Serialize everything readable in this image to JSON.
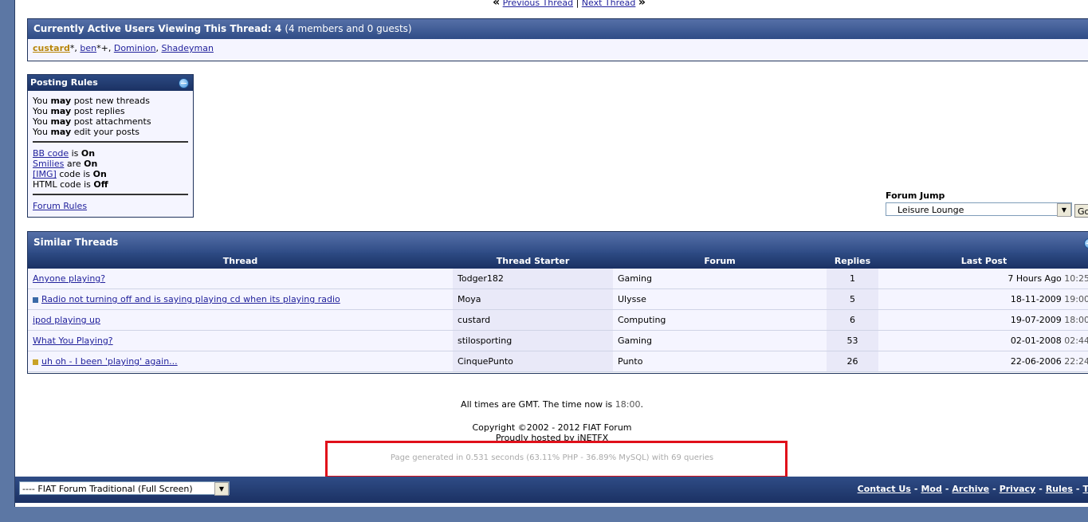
{
  "thread_nav": {
    "prev": "Previous Thread",
    "sep": "|",
    "next": "Next Thread"
  },
  "active_users": {
    "title": "Currently Active Users Viewing This Thread:",
    "count": "4",
    "detail": "(4 members and 0 guests)",
    "users": [
      {
        "name": "custard",
        "suffix": "*, "
      },
      {
        "name": "ben",
        "suffix": "*+, "
      },
      {
        "name": "Dominion",
        "suffix": ", "
      },
      {
        "name": "Shadeyman",
        "suffix": ""
      }
    ]
  },
  "posting_rules": {
    "title": "Posting Rules",
    "may": "may",
    "rules": [
      {
        "pre": "You",
        "post": "post new threads"
      },
      {
        "pre": "You",
        "post": "post replies"
      },
      {
        "pre": "You",
        "post": "post attachments"
      },
      {
        "pre": "You",
        "post": "edit your posts"
      }
    ],
    "codes": [
      {
        "link": "BB code",
        "mid": " is ",
        "state": "On"
      },
      {
        "link": "Smilies",
        "mid": " are ",
        "state": "On"
      },
      {
        "link": "[IMG]",
        "mid": " code is ",
        "state": "On"
      },
      {
        "link": "",
        "text": "HTML code is ",
        "state": "Off"
      }
    ],
    "forum_rules": "Forum Rules"
  },
  "forum_jump": {
    "label": "Forum Jump",
    "selected": "Leisure Lounge",
    "go": "Go"
  },
  "similar_threads": {
    "title": "Similar Threads",
    "columns": [
      "Thread",
      "Thread Starter",
      "Forum",
      "Replies",
      "Last Post"
    ],
    "rows": [
      {
        "thread": "Anyone playing?",
        "icon": "",
        "starter": "Todger182",
        "forum": "Gaming",
        "replies": "1",
        "last_date": "7 Hours Ago",
        "last_time": "10:25"
      },
      {
        "thread": "Radio not turning off and is saying playing cd when its playing radio",
        "icon": "#3a6aa8",
        "starter": "Moya",
        "forum": "Ulysse",
        "replies": "5",
        "last_date": "18-11-2009",
        "last_time": "19:00"
      },
      {
        "thread": "ipod playing up",
        "icon": "",
        "starter": "custard",
        "forum": "Computing",
        "replies": "6",
        "last_date": "19-07-2009",
        "last_time": "18:00"
      },
      {
        "thread": "What You Playing?",
        "icon": "",
        "starter": "stilosporting",
        "forum": "Gaming",
        "replies": "53",
        "last_date": "02-01-2008",
        "last_time": "02:44"
      },
      {
        "thread": "uh oh - I been 'playing' again...",
        "icon": "#c9a227",
        "starter": "CinquePunto",
        "forum": "Punto",
        "replies": "26",
        "last_date": "22-06-2006",
        "last_time": "22:24"
      }
    ]
  },
  "footer": {
    "times_pre": "All times are GMT. The time now is ",
    "time_now": "18:00",
    "times_post": ".",
    "copyright": "Copyright ©2002 - 2012 FIAT Forum",
    "hosted": "Proudly hosted by iNETFX",
    "page_generated": "Page generated in 0.531 seconds (63.11% PHP - 36.89% MySQL) with 69 queries"
  },
  "bottom_bar": {
    "style_selected": "---- FIAT Forum Traditional (Full Screen)",
    "links": [
      "Contact Us",
      "Mod",
      "Archive",
      "Privacy",
      "Rules",
      "T"
    ]
  },
  "colors": {
    "highlight": "#e0101a",
    "header": "#2f4c86",
    "background": "#5c77a4"
  }
}
